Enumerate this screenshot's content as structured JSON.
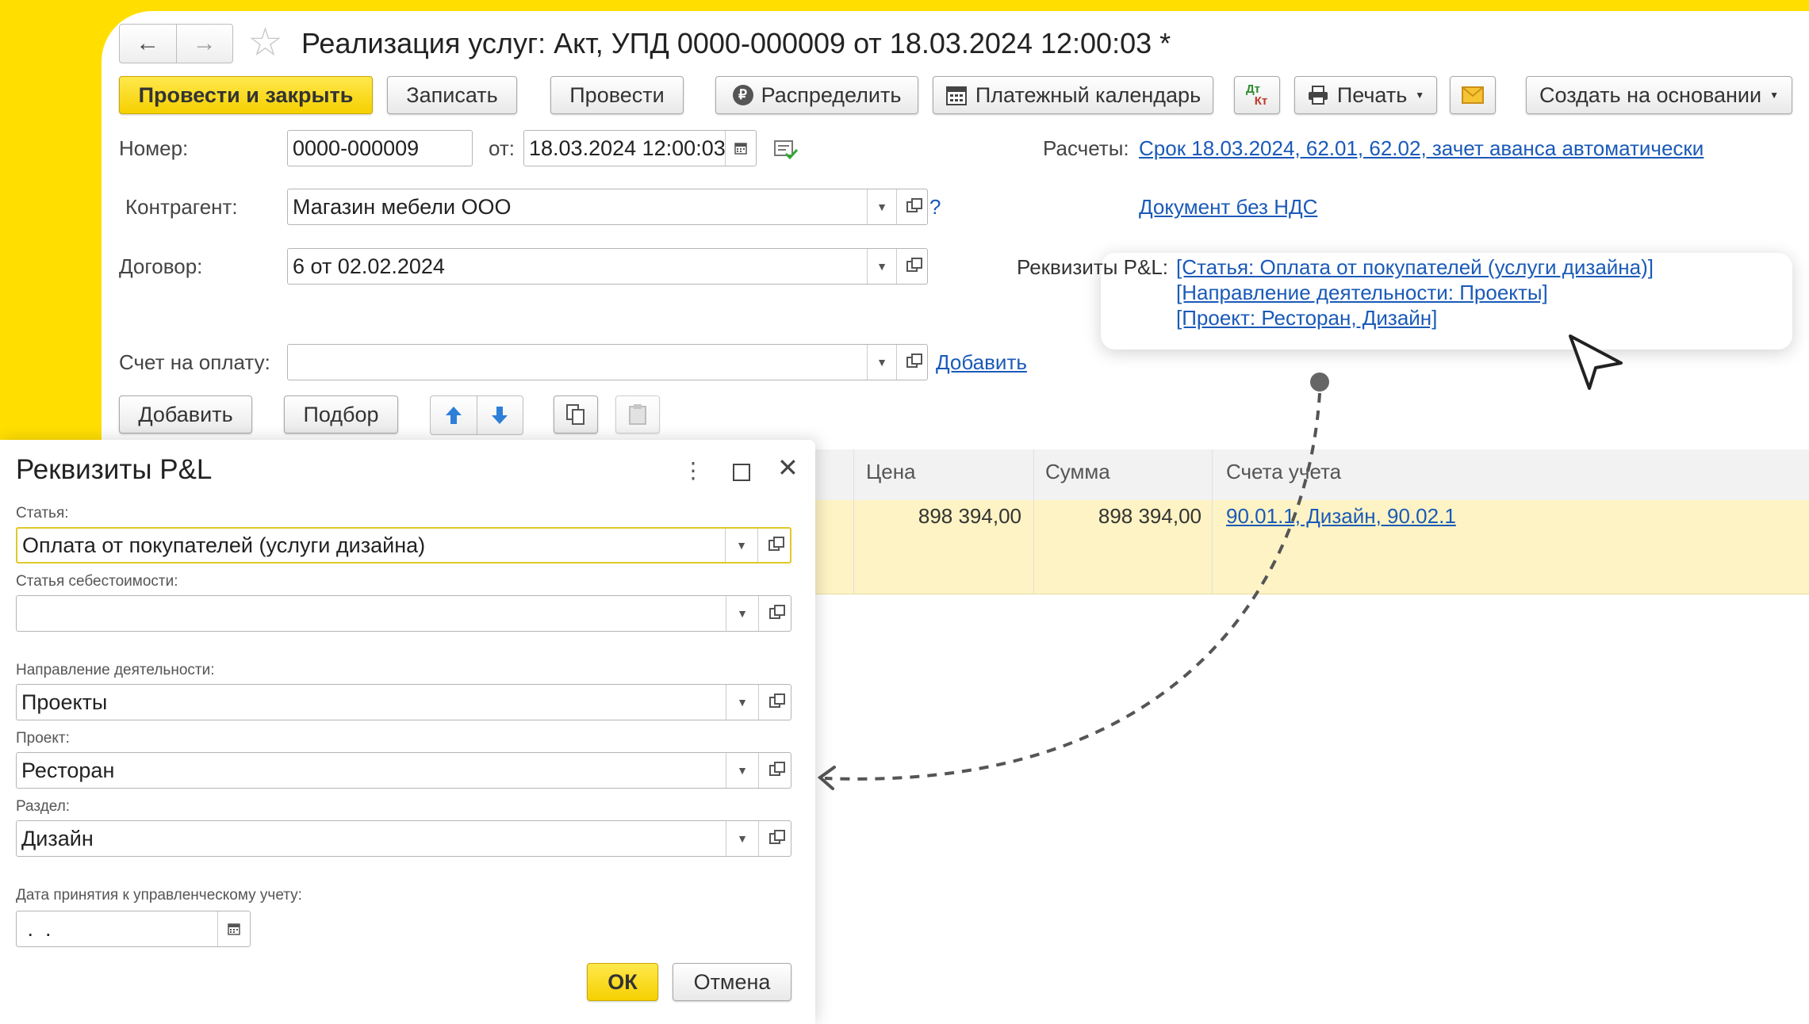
{
  "window": {
    "title": "Реализация услуг: Акт, УПД 0000-000009 от 18.03.2024 12:00:03 *",
    "nav_back": "←",
    "nav_forward": "→",
    "star": "☆"
  },
  "toolbar": {
    "post_close": "Провести и закрыть",
    "save": "Записать",
    "post": "Провести",
    "distribute": "Распределить",
    "payment_calendar": "Платежный календарь",
    "dtkt_top": "Дт",
    "dtkt_bottom": "Кт",
    "print": "Печать",
    "create_based": "Создать на основании"
  },
  "form": {
    "number_label": "Номер:",
    "number_value": "0000-000009",
    "date_label": "от:",
    "date_value": "18.03.2024 12:00:03",
    "settlements_label": "Расчеты:",
    "settlements_link": "Срок 18.03.2024, 62.01, 62.02, зачет аванса автоматически",
    "counterparty_label": "Контрагент:",
    "counterparty_value": "Магазин мебели ООО",
    "help": "?",
    "vat_link": "Документ без НДС",
    "contract_label": "Договор:",
    "contract_value": "6 от 02.02.2024",
    "invoice_label": "Счет на оплату:",
    "invoice_value": "",
    "invoice_add": "Добавить"
  },
  "popup": {
    "label": "Реквизиты P&L:",
    "line1": "[Статья: Оплата от покупателей (услуги дизайна)]",
    "line2": "[Направление деятельности: Проекты]",
    "line3": "[Проект: Ресторан, Дизайн]"
  },
  "table_toolbar": {
    "add": "Добавить",
    "select": "Подбор"
  },
  "table": {
    "headers": [
      "Цена",
      "Сумма",
      "Счета учета"
    ],
    "row": {
      "price": "898 394,00",
      "sum": "898 394,00",
      "accounts": "90.01.1, Дизайн, 90.02.1"
    }
  },
  "dialog": {
    "title": "Реквизиты P&L",
    "article_label": "Статья:",
    "article_value": "Оплата от покупателей (услуги дизайна)",
    "cost_label": "Статья себестоимости:",
    "cost_value": "",
    "direction_label": "Направление деятельности:",
    "direction_value": "Проекты",
    "project_label": "Проект:",
    "project_value": "Ресторан",
    "section_label": "Раздел:",
    "section_value": "Дизайн",
    "date_label": "Дата принятия к управленческому учету:",
    "date_value": " .  .",
    "ok": "ОК",
    "cancel": "Отмена"
  },
  "colors": {
    "accent_yellow": "#ffde00",
    "button_primary": "#f5d000",
    "link": "#1a5ab8",
    "row_highlight": "#fdf3c4"
  }
}
